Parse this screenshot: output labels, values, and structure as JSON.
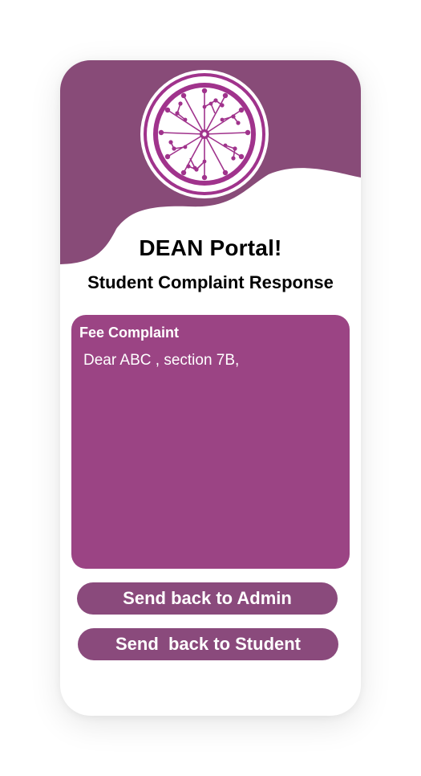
{
  "header": {
    "title": "DEAN Portal!",
    "subtitle": "Student Complaint Response",
    "logo_icon": "network-hub-logo-icon"
  },
  "complaint": {
    "type_label": "Fee Complaint",
    "text": "Dear ABC , section 7B,"
  },
  "actions": {
    "send_admin_label": "Send back to Admin",
    "send_student_label": "Send  back to Student"
  },
  "colors": {
    "header_purple": "#884b78",
    "card_purple": "#9b4484",
    "button_purple": "#8a4a7c",
    "logo_purple": "#a0338c"
  }
}
